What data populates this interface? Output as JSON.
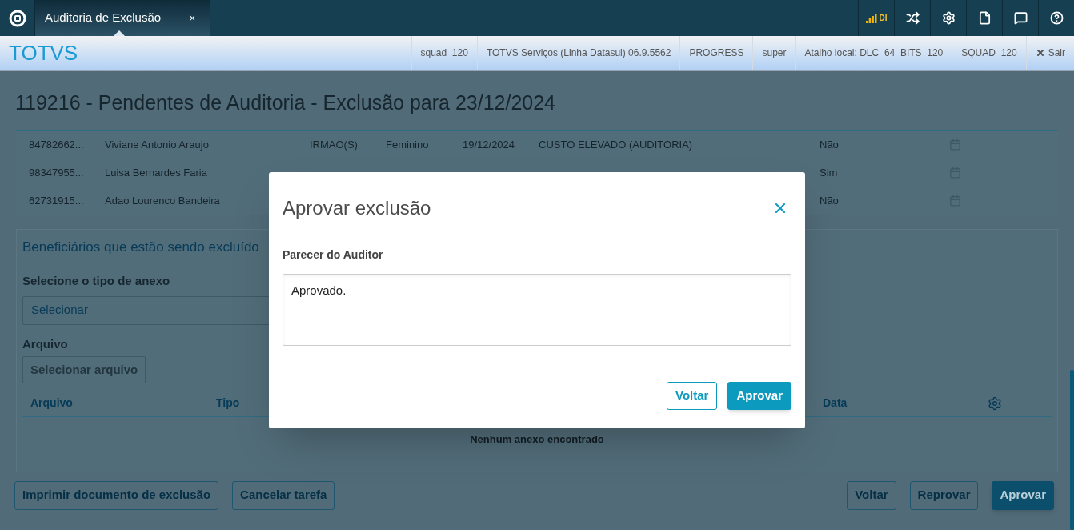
{
  "top_bar": {
    "tab": {
      "label": "Auditoria de Exclusão",
      "close": "×",
      "selected": true
    },
    "signal_label": "DI"
  },
  "info_bar": {
    "logo": "TOTVS",
    "items": [
      "squad_120",
      "TOTVS Serviços (Linha Datasul) 06.9.5562",
      "PROGRESS",
      "super",
      "Atalho local: DLC_64_BITS_120",
      "SQUAD_120"
    ],
    "exit": "Sair"
  },
  "page": {
    "title": "119216 - Pendentes de Auditoria - Exclusão para 23/12/2024",
    "rows": [
      {
        "code": "84782662...",
        "name": "Viviane Antonio Araujo",
        "relation": "IRMAO(S)",
        "sex": "Feminino",
        "date": "19/12/2024",
        "reason": "CUSTO ELEVADO (AUDITORIA)",
        "flag": "Não"
      },
      {
        "code": "98347955...",
        "name": "Luisa Bernardes Faria",
        "flag": "Sim"
      },
      {
        "code": "62731915...",
        "name": "Adao Lourenco Bandeira",
        "flag": "Não"
      }
    ],
    "section": {
      "title": "Beneficiários que estão sendo excluído",
      "type_label": "Selecione o tipo de anexo",
      "type_placeholder": "Selecionar",
      "file_label": "Arquivo",
      "file_button": {
        "label": "Selecionar arquivo",
        "disabled": true
      },
      "columns": [
        "Arquivo",
        "Tipo",
        "Data"
      ],
      "empty": "Nenhum anexo encontrado"
    },
    "left_buttons": [
      {
        "label": "Imprimir documento de exclusão",
        "kind": "outline"
      },
      {
        "label": "Cancelar tarefa",
        "kind": "outline"
      }
    ],
    "right_buttons": [
      {
        "label": "Voltar",
        "kind": "outline"
      },
      {
        "label": "Reprovar",
        "kind": "outline"
      },
      {
        "label": "Aprovar",
        "kind": "primary"
      }
    ]
  },
  "dialog": {
    "title": "Aprovar exclusão",
    "field_label": "Parecer do Auditor",
    "field_value": "Aprovado.",
    "buttons": [
      {
        "label": "Voltar",
        "kind": "outline"
      },
      {
        "label": "Aprovar",
        "kind": "primary"
      }
    ]
  }
}
